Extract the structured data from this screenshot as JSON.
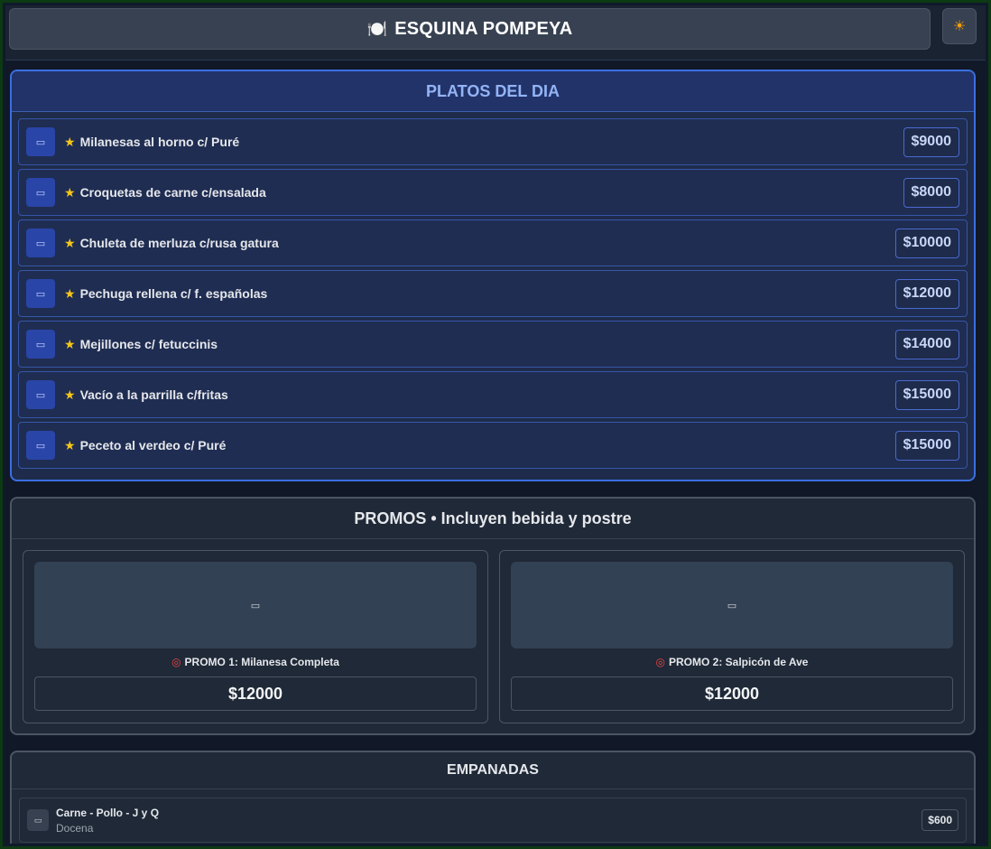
{
  "header": {
    "title_icon": "🍽️",
    "title": "ESQUINA POMPEYA",
    "theme_icon": "☀"
  },
  "daily": {
    "title": "PLATOS DEL DIA",
    "thumb_icon": "▭",
    "star_icon": "★",
    "items": [
      {
        "name": "Milanesas al horno c/ Puré",
        "price": "$9000"
      },
      {
        "name": "Croquetas de carne c/ensalada",
        "price": "$8000"
      },
      {
        "name": "Chuleta de merluza c/rusa gatura",
        "price": "$10000"
      },
      {
        "name": "Pechuga rellena c/ f. españolas",
        "price": "$12000"
      },
      {
        "name": "Mejillones c/ fetuccinis",
        "price": "$14000"
      },
      {
        "name": "Vacío a la parrilla c/fritas",
        "price": "$15000"
      },
      {
        "name": "Peceto al verdeo c/ Puré",
        "price": "$15000"
      }
    ]
  },
  "promos": {
    "title": "PROMOS • Incluyen bebida y postre",
    "image_icon": "▭",
    "pin_icon": "◎",
    "items": [
      {
        "name": "PROMO 1: Milanesa Completa",
        "price": "$12000"
      },
      {
        "name": "PROMO 2: Salpicón de Ave",
        "price": "$12000"
      }
    ]
  },
  "empanadas": {
    "title": "EMPANADAS",
    "thumb_icon": "▭",
    "items": [
      {
        "name": "Carne - Pollo - J y Q",
        "unit": "Docena",
        "price": "$600"
      }
    ]
  },
  "colors": {
    "accent_blue": "#3b6fe0",
    "star": "#f5c518",
    "frame_green": "#0c3a12"
  }
}
